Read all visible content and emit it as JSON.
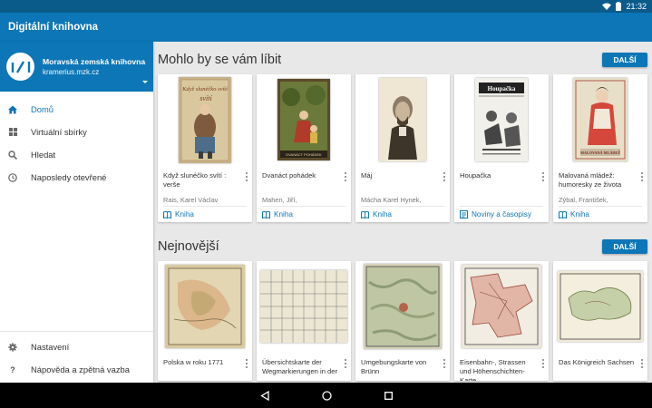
{
  "status_bar": {
    "time": "21:32"
  },
  "app_bar": {
    "title": "Digitální knihovna"
  },
  "drawer": {
    "library_name": "Moravská zemská knihovna",
    "library_url": "kramerius.mzk.cz",
    "items": [
      {
        "label": "Domů",
        "icon": "home-icon"
      },
      {
        "label": "Virtuální sbírky",
        "icon": "grid-icon"
      },
      {
        "label": "Hledat",
        "icon": "search-icon"
      },
      {
        "label": "Naposledy otevřené",
        "icon": "clock-icon"
      }
    ],
    "bottom_items": [
      {
        "label": "Nastavení",
        "icon": "gear-icon"
      },
      {
        "label": "Nápověda a zpětná vazba",
        "icon": "help-icon"
      }
    ],
    "accent_color": "#0d76b6"
  },
  "sections": [
    {
      "title": "Mohlo by se vám líbit",
      "more_label": "DALŠÍ",
      "cards": [
        {
          "title": "Když slunéčko svítí : verše",
          "author": "Rais, Karel Václav",
          "type": "Kniha",
          "type_icon": "book-icon"
        },
        {
          "title": "Dvanáct pohádek",
          "author": "Mahen, Jiří,",
          "type": "Kniha",
          "type_icon": "book-icon"
        },
        {
          "title": "Máj",
          "author": "Mácha Karel Hynek,",
          "type": "Kniha",
          "type_icon": "book-icon"
        },
        {
          "title": "Houpačka",
          "author": "",
          "type": "Noviny a časopisy",
          "type_icon": "newspaper-icon"
        },
        {
          "title": "Malovaná mládež: humoresky ze života",
          "author": "Zýbal, František,",
          "type": "Kniha",
          "type_icon": "book-icon"
        }
      ]
    },
    {
      "title": "Nejnovější",
      "more_label": "DALŠÍ",
      "cards": [
        {
          "title": "Polska w roku 1771"
        },
        {
          "title": "Übersichtskarte der Wegmarkierungen in der"
        },
        {
          "title": "Umgebungskarte von Brünn"
        },
        {
          "title": "Eisenbahn-, Strassen und Höhenschichten-Karte"
        },
        {
          "title": "Das Königreich Sachsen"
        }
      ]
    }
  ],
  "cover_art": {
    "book1_text": "Když slunéčko svítí",
    "book2_text": "DVANÁCT POHÁDEK",
    "mag_text": "Houpačka",
    "book5_text": "MALOVANÁ MLÁDEŽ"
  }
}
